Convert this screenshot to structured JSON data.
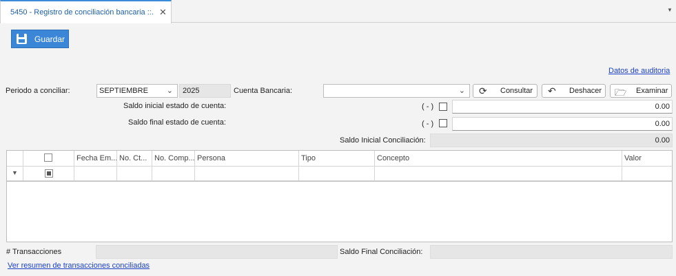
{
  "tab": {
    "title": "5450 - Registro de conciliación bancaria ::.",
    "close": "✕",
    "menu": "▼"
  },
  "toolbar": {
    "save_label": "Guardar"
  },
  "audit_link": "Datos de auditoria",
  "period": {
    "label": "Periodo a conciliar:",
    "month": "SEPTIEMBRE",
    "year": "2025"
  },
  "account": {
    "label": "Cuenta Bancaria:",
    "value": ""
  },
  "buttons": {
    "consult": "Consultar",
    "undo": "Deshacer",
    "browse": "Examinar"
  },
  "balances": {
    "initial_statement_label": "Saldo inicial estado de cuenta:",
    "initial_statement_value": "0.00",
    "final_statement_label": "Saldo final estado de cuenta:",
    "final_statement_value": "0.00",
    "negative_marker": "( - )",
    "initial_reconciliation_label": "Saldo Inicial Conciliación:",
    "initial_reconciliation_value": "0.00"
  },
  "grid": {
    "columns": [
      "Fecha Em...",
      "No. Ct...",
      "No. Comp...",
      "Persona",
      "Tipo",
      "Concepto",
      "Valor"
    ],
    "filter_icon": "▼"
  },
  "footer": {
    "transactions_label": "# Transacciones",
    "transactions_value": "",
    "final_reconciliation_label": "Saldo Final Conciliación:",
    "final_reconciliation_value": "",
    "summary_link": "Ver resumen de transacciones conciliadas"
  }
}
